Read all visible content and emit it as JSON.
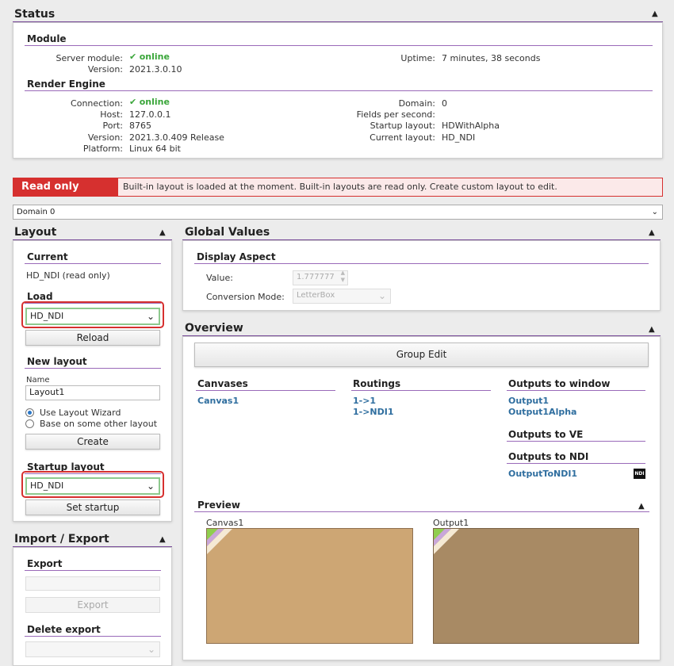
{
  "status": {
    "title": "Status",
    "module": {
      "title": "Module",
      "server_label": "Server module:",
      "server_value": "online",
      "version_label": "Version:",
      "version_value": "2021.3.0.10",
      "uptime_label": "Uptime:",
      "uptime_value": "7 minutes, 38 seconds"
    },
    "render": {
      "title": "Render Engine",
      "connection_label": "Connection:",
      "connection_value": "online",
      "host_label": "Host:",
      "host_value": "127.0.0.1",
      "port_label": "Port:",
      "port_value": "8765",
      "version_label": "Version:",
      "version_value": "2021.3.0.409 Release",
      "platform_label": "Platform:",
      "platform_value": "Linux 64 bit",
      "domain_label": "Domain:",
      "domain_value": "0",
      "fps_label": "Fields per second:",
      "fps_value": "",
      "startup_label": "Startup layout:",
      "startup_value": "HDWithAlpha",
      "current_label": "Current layout:",
      "current_value": "HD_NDI"
    }
  },
  "banner": {
    "tag": "Read only",
    "message": "Built-in layout is loaded at the moment. Built-in layouts are read only. Create custom layout to edit."
  },
  "domain_select": {
    "value": "Domain 0"
  },
  "layout": {
    "title": "Layout",
    "current_title": "Current",
    "current_value": "HD_NDI (read only)",
    "load_title": "Load",
    "load_value": "HD_NDI",
    "reload_label": "Reload",
    "new_title": "New layout",
    "name_label": "Name",
    "name_value": "Layout1",
    "wizard_label": "Use Layout Wizard",
    "base_label": "Base on some other layout",
    "create_label": "Create",
    "startup_title": "Startup layout",
    "startup_value": "HD_NDI",
    "set_startup_label": "Set startup"
  },
  "import_export": {
    "title": "Import / Export",
    "export_title": "Export",
    "export_label": "Export",
    "delete_title": "Delete export"
  },
  "global": {
    "title": "Global Values",
    "display_title": "Display Aspect",
    "value_label": "Value:",
    "value_value": "1.777777",
    "conversion_label": "Conversion Mode:",
    "conversion_value": "LetterBox"
  },
  "overview": {
    "title": "Overview",
    "group_edit_label": "Group Edit",
    "canvases_title": "Canvases",
    "canvases": [
      "Canvas1"
    ],
    "routings_title": "Routings",
    "routings": [
      "1->1",
      "1->NDI1"
    ],
    "outputs_window_title": "Outputs to window",
    "outputs_window": [
      "Output1",
      "Output1Alpha"
    ],
    "outputs_ve_title": "Outputs to VE",
    "outputs_ndi_title": "Outputs to NDI",
    "outputs_ndi": [
      "OutputToNDI1"
    ],
    "ndi_badge": "NDI"
  },
  "preview": {
    "title": "Preview",
    "canvas_label": "Canvas1",
    "output_label": "Output1"
  },
  "colors": {
    "accent_line": "#7a4a9c",
    "online": "#3aa63a",
    "link": "#2f6e9f",
    "read_only_red": "#d6302f",
    "canvas_preview": "#cda674",
    "output_preview": "#a88a64"
  },
  "icons": {
    "collapse": "chevron-up-icon",
    "dropdown": "chevron-down-icon",
    "check": "check-icon"
  }
}
